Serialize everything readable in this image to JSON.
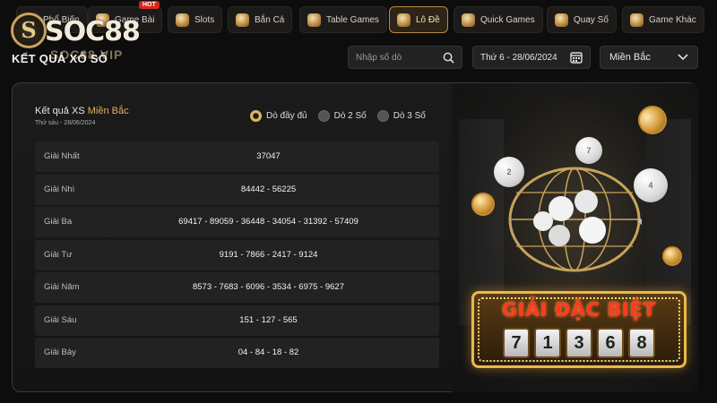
{
  "nav": {
    "hot_badge": "HOT",
    "items": [
      {
        "label": "Phổ Biến",
        "icon": "star-icon"
      },
      {
        "label": "Game Bài",
        "icon": "cards-icon"
      },
      {
        "label": "Slots",
        "icon": "slot-machine-icon"
      },
      {
        "label": "Bắn Cá",
        "icon": "fish-icon"
      },
      {
        "label": "Table Games",
        "icon": "table-game-icon"
      },
      {
        "label": "Lô Đề",
        "icon": "lottery-icon",
        "active": true
      },
      {
        "label": "Quick Games",
        "icon": "quick-game-icon"
      },
      {
        "label": "Quay Số",
        "icon": "lottery-balls-icon"
      },
      {
        "label": "Game Khác",
        "icon": "gamepad-icon"
      }
    ]
  },
  "logo": {
    "main": "SOC88",
    "sub": "SOC88.VIP",
    "letter": "S"
  },
  "header": {
    "title": "KẾT QUẢ XỔ SỐ",
    "search_placeholder": "Nhập số dò",
    "date_value": "Thứ 6 - 28/06/2024",
    "region_value": "Miền Bắc"
  },
  "results": {
    "title_prefix": "Kết quả XS ",
    "title_region": "Miền Bắc",
    "date_line": "Thứ sáu - 28/06/2024",
    "radio_options": [
      {
        "label": "Dò đầy đủ",
        "selected": true
      },
      {
        "label": "Dò 2 Số",
        "selected": false
      },
      {
        "label": "Dò 3 Số",
        "selected": false
      }
    ],
    "rows": [
      {
        "label": "Giải Nhất",
        "values": "37047"
      },
      {
        "label": "Giải Nhì",
        "values": "84442  -  56225"
      },
      {
        "label": "Giải Ba",
        "values": "69417  -  89059  -  36448  -  34054  -  31392  -  57409"
      },
      {
        "label": "Giải Tư",
        "values": "9191  -  7866  -  2417  -  9124"
      },
      {
        "label": "Giải Năm",
        "values": "8573  -  7683  -  6096  -  3534  -  6975  -  9627"
      },
      {
        "label": "Giải Sáu",
        "values": "151  -  127  -  565"
      },
      {
        "label": "Giải Bảy",
        "values": "04  -  84  -  18  -  82"
      }
    ]
  },
  "special_prize": {
    "title": "GIẢI ĐẶC BIỆT",
    "digits": [
      "7",
      "1",
      "3",
      "6",
      "8"
    ]
  },
  "balls": [
    "2",
    "7",
    "4"
  ],
  "colors": {
    "accent": "#e0b062",
    "board_red": "#ff3a22"
  }
}
